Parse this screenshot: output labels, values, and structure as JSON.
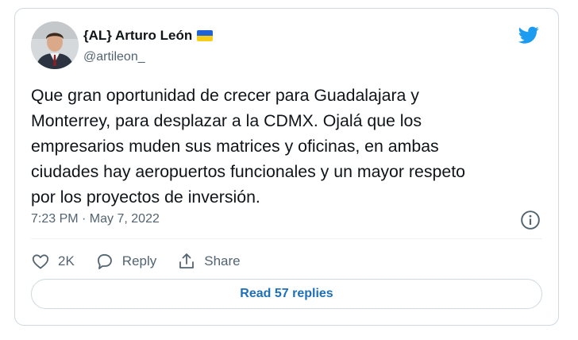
{
  "tweet": {
    "author_name": "{AL} Arturo León",
    "handle": "@artileon_",
    "text": "Que gran oportunidad de crecer para Guadalajara y\nMonterrey, para desplazar a la CDMX. Ojalá que los\nempresarios muden sus matrices y oficinas, en ambas\nciudades hay aeropuertos funcionales y un mayor respeto\npor los proyectos de inversión.",
    "timestamp": "7:23 PM · May 7, 2022"
  },
  "actions": {
    "like_count": "2K",
    "reply_label": "Reply",
    "share_label": "Share"
  },
  "read_replies_label": "Read 57 replies",
  "colors": {
    "brand": "#1d9bf0",
    "link": "#1d6fb8",
    "muted": "#536471",
    "border": "#cfd9de"
  },
  "icons": [
    "twitter-bird-icon",
    "info-icon",
    "heart-icon",
    "reply-icon",
    "share-icon",
    "ukraine-flag-icon"
  ]
}
